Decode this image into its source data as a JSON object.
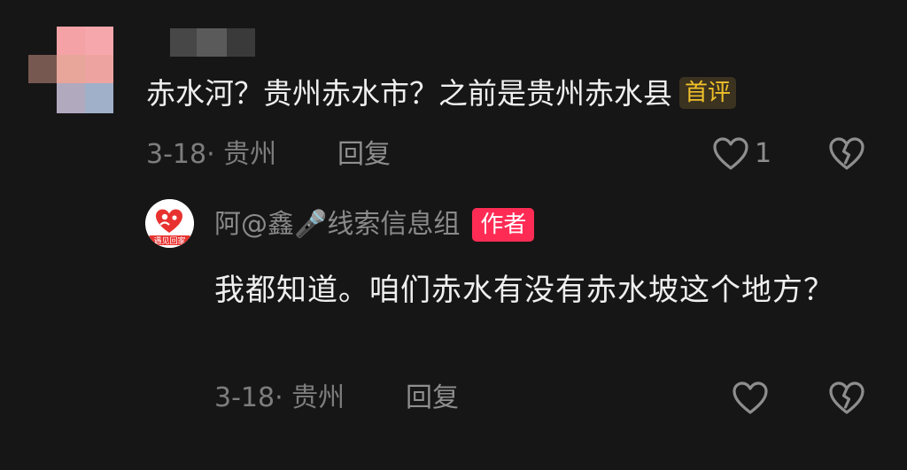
{
  "comment": {
    "text": "赤水河？贵州赤水市？之前是贵州赤水县",
    "badge": "首评",
    "date": "3-18",
    "location": "贵州",
    "reply_label": "回复",
    "like_count": "1"
  },
  "reply": {
    "author": "阿@鑫🎤线索信息组",
    "author_badge": "作者",
    "avatar_text": "遇见回家",
    "text": "我都知道。咱们赤水有没有赤水坡这个地方？",
    "date": "3-18",
    "location": "贵州",
    "reply_label": "回复"
  },
  "colors": {
    "background": "#161616",
    "author_badge": "#fe2c55",
    "first_badge_text": "#f0c02a"
  },
  "icons": [
    "heart-icon",
    "broken-heart-icon",
    "microphone-icon"
  ]
}
